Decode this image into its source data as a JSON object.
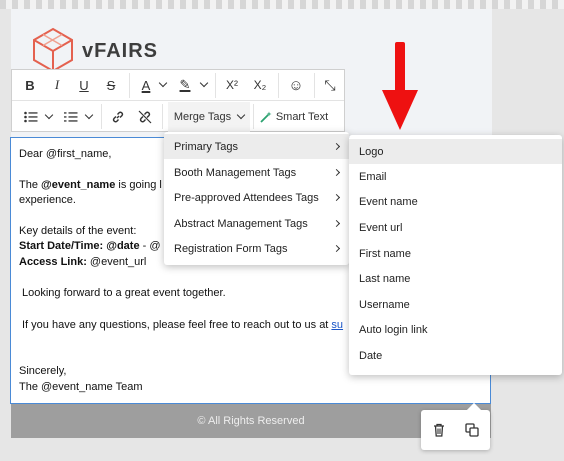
{
  "brand": {
    "name": "vFAIRS",
    "accent": "#e4614f",
    "arrow_color": "#ee1111"
  },
  "toolbar": {
    "row1": [
      {
        "icon": "bold-icon",
        "glyph": "B"
      },
      {
        "icon": "italic-icon",
        "glyph": "I"
      },
      {
        "icon": "underline-icon",
        "glyph": "U"
      },
      {
        "icon": "strikethrough-icon",
        "glyph": "S"
      },
      {
        "icon": "font-color-icon",
        "glyph": "A"
      },
      {
        "icon": "highlight-icon",
        "glyph": "✎"
      },
      {
        "icon": "superscript-icon",
        "glyph": "X²"
      },
      {
        "icon": "subscript-icon",
        "glyph": "X₂"
      },
      {
        "icon": "emoji-icon",
        "glyph": "☺"
      },
      {
        "icon": "collapse-icon",
        "glyph": "⤡"
      }
    ],
    "merge_tags_label": "Merge Tags",
    "smart_text_label": "Smart Text"
  },
  "editor": {
    "greeting": "Dear @first_name,",
    "line1_bold": "@event_name",
    "line1_pre": "The ",
    "line1_post": " is going l",
    "line2": "experience.",
    "key_details": "Key details of the event:",
    "start_label": "Start Date/Time:",
    "start_value": " @date",
    "start_tail": " - @",
    "access_label": "Access Link:",
    "access_value": " @event_url",
    "looking_forward": "Looking forward to a great event together.",
    "questions": "If you have any questions, please feel free to reach out to us at ",
    "questions_link": "su",
    "sincerely": "Sincerely,",
    "team": "The @event_name Team"
  },
  "footer": {
    "text": "© All Rights Reserved"
  },
  "merge_menu": {
    "items": [
      {
        "label": "Primary Tags",
        "active": true
      },
      {
        "label": "Booth Management Tags",
        "active": false
      },
      {
        "label": "Pre-approved Attendees Tags",
        "active": false
      },
      {
        "label": "Abstract Management Tags",
        "active": false
      },
      {
        "label": "Registration Form Tags",
        "active": false
      }
    ]
  },
  "primary_tags_menu": {
    "items": [
      {
        "label": "Logo",
        "active": true
      },
      {
        "label": "Email"
      },
      {
        "label": "Event name"
      },
      {
        "label": "Event url"
      },
      {
        "label": "First name"
      },
      {
        "label": "Last name"
      },
      {
        "label": "Username"
      },
      {
        "label": "Auto login link"
      },
      {
        "label": "Date"
      }
    ]
  },
  "block_actions": {
    "delete_icon": "trash-icon",
    "duplicate_icon": "duplicate-icon"
  }
}
